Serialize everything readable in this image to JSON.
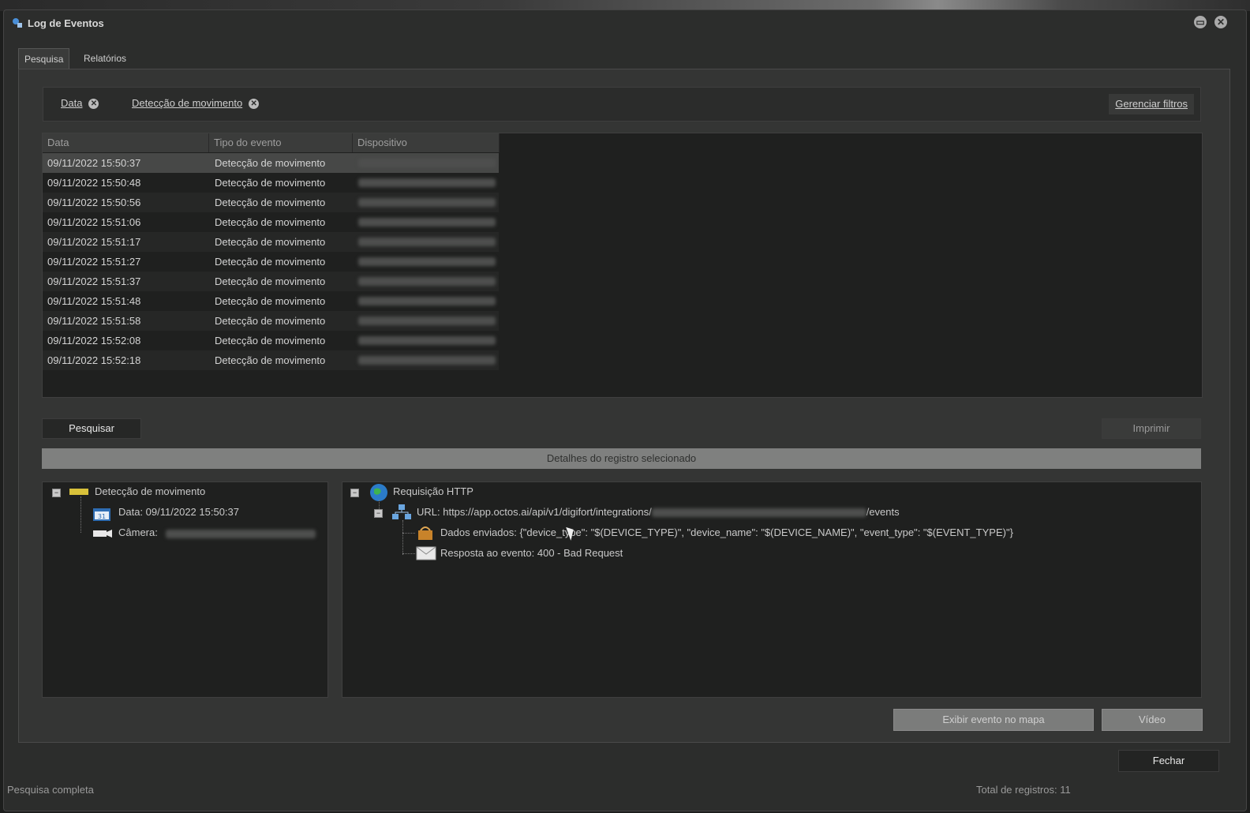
{
  "window": {
    "title": "Log de Eventos",
    "minimize_icon": "▭",
    "close_icon": "✕"
  },
  "tabs": [
    {
      "label": "Pesquisa",
      "active": true
    },
    {
      "label": "Relatórios",
      "active": false
    }
  ],
  "filters": {
    "chips": [
      {
        "label": "Data"
      },
      {
        "label": "Detecção de movimento"
      }
    ],
    "manage_label": "Gerenciar filtros"
  },
  "grid": {
    "columns": [
      "Data",
      "Tipo do evento",
      "Dispositivo"
    ],
    "rows": [
      {
        "date": "09/11/2022 15:50:37",
        "type": "Detecção de movimento"
      },
      {
        "date": "09/11/2022 15:50:48",
        "type": "Detecção de movimento"
      },
      {
        "date": "09/11/2022 15:50:56",
        "type": "Detecção de movimento"
      },
      {
        "date": "09/11/2022 15:51:06",
        "type": "Detecção de movimento"
      },
      {
        "date": "09/11/2022 15:51:17",
        "type": "Detecção de movimento"
      },
      {
        "date": "09/11/2022 15:51:27",
        "type": "Detecção de movimento"
      },
      {
        "date": "09/11/2022 15:51:37",
        "type": "Detecção de movimento"
      },
      {
        "date": "09/11/2022 15:51:48",
        "type": "Detecção de movimento"
      },
      {
        "date": "09/11/2022 15:51:58",
        "type": "Detecção de movimento"
      },
      {
        "date": "09/11/2022 15:52:08",
        "type": "Detecção de movimento"
      },
      {
        "date": "09/11/2022 15:52:18",
        "type": "Detecção de movimento"
      }
    ]
  },
  "buttons": {
    "search": "Pesquisar",
    "print": "Imprimir",
    "show_map": "Exibir evento no mapa",
    "video": "Vídeo",
    "close": "Fechar"
  },
  "details": {
    "header": "Detalhes do registro selecionado",
    "left_tree": {
      "root": "Detecção de movimento",
      "date": "Data: 09/11/2022 15:50:37",
      "camera": "Câmera:"
    },
    "right_tree": {
      "root": "Requisição HTTP",
      "url_prefix": "URL: https://app.octos.ai/api/v1/digifort/integrations/",
      "url_suffix": "/events",
      "sent_data": "Dados enviados: {\"device_type\": \"$(DEVICE_TYPE)\", \"device_name\": \"$(DEVICE_NAME)\", \"event_type\": \"$(EVENT_TYPE)\"}",
      "response": "Resposta ao evento: 400 - Bad Request"
    }
  },
  "status": {
    "left": "Pesquisa completa",
    "right": "Total de registros: 11"
  }
}
